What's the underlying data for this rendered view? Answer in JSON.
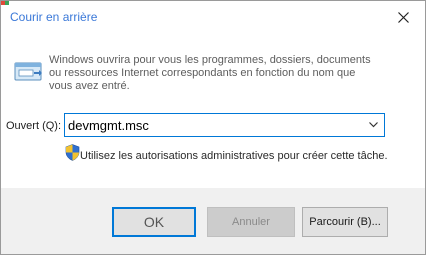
{
  "window": {
    "title": "Courir en arrière",
    "title_color": "#3a78d8"
  },
  "description": "Windows ouvrira pour vous les programmes, dossiers, documents ou ressources Internet correspondants en fonction du nom que vous avez entré.",
  "open_field": {
    "label": "Ouvert (Q):",
    "value": "devmgmt.msc"
  },
  "admin_note": "Utilisez les autorisations administratives pour créer cette tâche.",
  "buttons": {
    "ok": "OK",
    "cancel": "Annuler",
    "browse": "Parcourir (B)..."
  },
  "icons": {
    "close": "close-icon",
    "run": "run-dialog-icon",
    "dropdown": "chevron-down-icon",
    "shield": "uac-shield-icon"
  },
  "colors": {
    "accent": "#0078d7",
    "dialog_bg": "#f0f0f0"
  }
}
